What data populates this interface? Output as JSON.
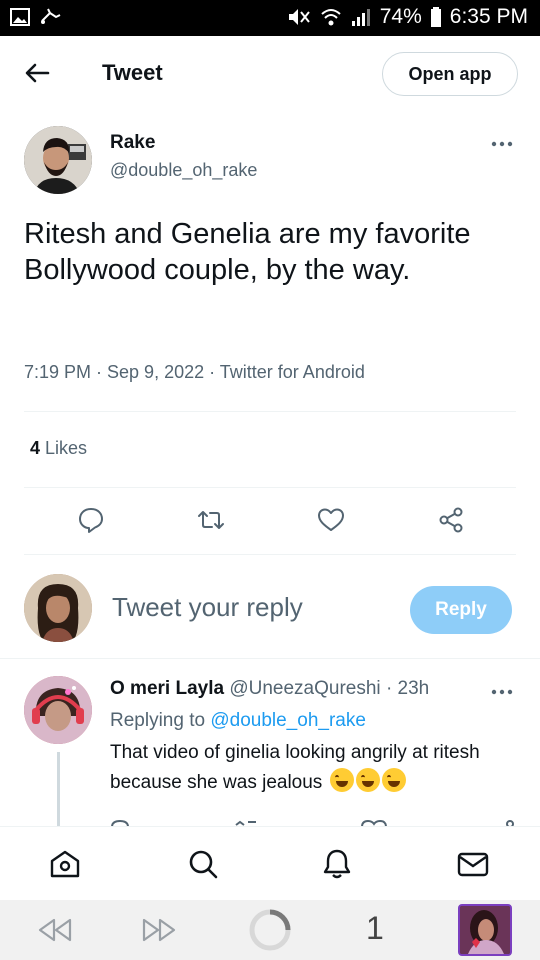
{
  "status_bar": {
    "battery_text": "74%",
    "time": "6:35 PM"
  },
  "header": {
    "back_icon": "arrow-left-icon",
    "title": "Tweet",
    "open_app_label": "Open app"
  },
  "tweet": {
    "author_name": "Rake",
    "author_handle": "@double_oh_rake",
    "text": "Ritesh and Genelia are my favorite Bollywood couple, by the way.",
    "meta": "7:19 PM · Sep 9, 2022 · Twitter for Android",
    "likes_count": "4",
    "likes_label": "Likes"
  },
  "composer": {
    "placeholder": "Tweet your reply",
    "reply_label": "Reply"
  },
  "reply": {
    "name": "O meri Layla",
    "handle": "@UneezaQureshi",
    "time": "· 23h",
    "replying_prefix": "Replying to",
    "replying_handle": "@double_oh_rake",
    "text": "That video of ginelia looking angrily at ritesh because she was jealous"
  },
  "bottom_nav": [
    "home-icon",
    "search-icon",
    "notifications-icon",
    "messages-icon"
  ],
  "system_bar": {
    "tab_count": "1"
  },
  "colors": {
    "accent": "#1d9bf0",
    "reply_button": "#8ecdf8",
    "muted": "#536471"
  }
}
